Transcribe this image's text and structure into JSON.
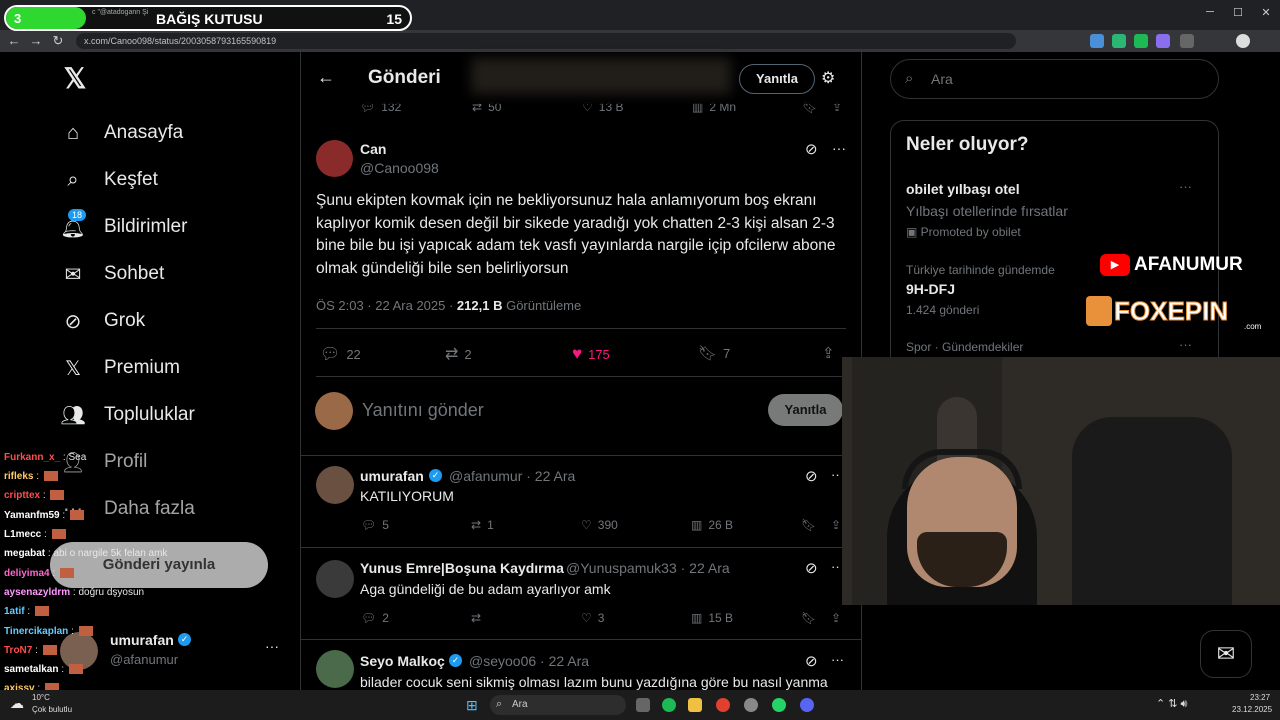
{
  "donation": {
    "level": "3",
    "title": "BAĞIŞ KUTUSU",
    "count": "15",
    "ticker": "c \"@atadogann Şi"
  },
  "browser": {
    "url": "x.com/Canoo098/status/2003058793165590819"
  },
  "nav": {
    "items": [
      {
        "label": "Anasayfa"
      },
      {
        "label": "Keşfet"
      },
      {
        "label": "Bildirimler"
      },
      {
        "label": "Sohbet"
      },
      {
        "label": "Grok"
      },
      {
        "label": "Premium"
      },
      {
        "label": "Topluluklar"
      },
      {
        "label": "Profil"
      },
      {
        "label": "Daha fazla"
      }
    ],
    "badge": "18",
    "post_button": "Gönderi yayınla",
    "account": {
      "name": "umurafan",
      "handle": "@afanumur"
    }
  },
  "header": {
    "title": "Gönderi",
    "reply_button": "Yanıtla"
  },
  "top_stats": {
    "replies": "132",
    "reposts": "50",
    "likes": "13 B",
    "views": "2 Mn"
  },
  "post": {
    "name": "Can",
    "handle": "@Canoo098",
    "text": "Şunu ekipten kovmak için ne bekliyorsunuz hala anlamıyorum boş ekranı kaplıyor komik desen değil bir sikede yaradığı yok chatten 2-3 kişi alsan 2-3 bine bile bu işi yapıcak adam tek vasfı yayınlarda nargile içip ofcilerw abone olmak gündeliği bile sen belirliyorsun",
    "time": "ÖS 2:03 · 22 Ara 2025 · ",
    "views": "212,1 B",
    "views_label": " Görüntüleme",
    "replies": "22",
    "reposts": "2",
    "likes": "175",
    "bookmarks": "7"
  },
  "compose": {
    "placeholder": "Yanıtını gönder",
    "button": "Yanıtla"
  },
  "replies": [
    {
      "name": "umurafan",
      "handle": "@afanumur · 22 Ara",
      "text": "KATILIYORUM",
      "replies": "5",
      "reposts": "1",
      "likes": "390",
      "views": "26 B"
    },
    {
      "name": "Yunus Emre|Boşuna Kaydırma",
      "handle": "@Yunuspamuk33 · 22 Ara",
      "text": "Aga gündeliği de bu adam ayarlıyor amk",
      "replies": "2",
      "reposts": "",
      "likes": "3",
      "views": "15 B"
    },
    {
      "name": "Seyo Malkoç",
      "handle": "@seyoo06 · 22 Ara",
      "text": "bilader cocuk seni sikmiş olması lazım bunu yazdığına göre bu nasıl yanma"
    }
  ],
  "search": {
    "placeholder": "Ara"
  },
  "trends": {
    "title": "Neler oluyor?",
    "items": [
      {
        "name": "obilet yılbaşı otel",
        "desc": "Yılbaşı otellerinde fırsatlar",
        "meta": "Promoted by obilet"
      },
      {
        "context": "Türkiye tarihinde gündemde",
        "name": "9H-DFJ",
        "meta": "1.424 gönderi"
      },
      {
        "context": "Spor · Gündemdekiler"
      }
    ]
  },
  "overlay": {
    "youtube": "AFANUMUR",
    "sponsor": "FOXEPIN",
    "sponsor_sub": ".com"
  },
  "chat": [
    {
      "user": "Furkann_x_",
      "msg": "Sea",
      "color": "#ff4d4d"
    },
    {
      "user": "rifleks",
      "msg": "",
      "color": "#ffcc66"
    },
    {
      "user": "cripttex",
      "msg": "",
      "color": "#ff4d4d"
    },
    {
      "user": "Yamanfm59",
      "msg": "",
      "color": "#ffffff"
    },
    {
      "user": "L1mecc",
      "msg": "",
      "color": "#ffffff"
    },
    {
      "user": "megabat",
      "msg": "abi o nargile 5k felan amk",
      "color": "#ffffff"
    },
    {
      "user": "deliyima4",
      "msg": "",
      "color": "#ff66cc"
    },
    {
      "user": "aysenazyldrm",
      "msg": "doğru dşyosun",
      "color": "#ff99ff"
    },
    {
      "user": "1atif",
      "msg": "",
      "color": "#66ccff"
    },
    {
      "user": "Tinercikaplan",
      "msg": "",
      "color": "#66ccff"
    },
    {
      "user": "TroN7",
      "msg": "",
      "color": "#ff4d4d"
    },
    {
      "user": "sametalkan",
      "msg": "",
      "color": "#ffffff"
    },
    {
      "user": "axissv",
      "msg": "",
      "color": "#ffcc66"
    }
  ],
  "taskbar": {
    "search": "Ara",
    "weather": "10°C",
    "weather_desc": "Çok bulutlu",
    "time": "23:27",
    "date": "23.12.2025"
  }
}
